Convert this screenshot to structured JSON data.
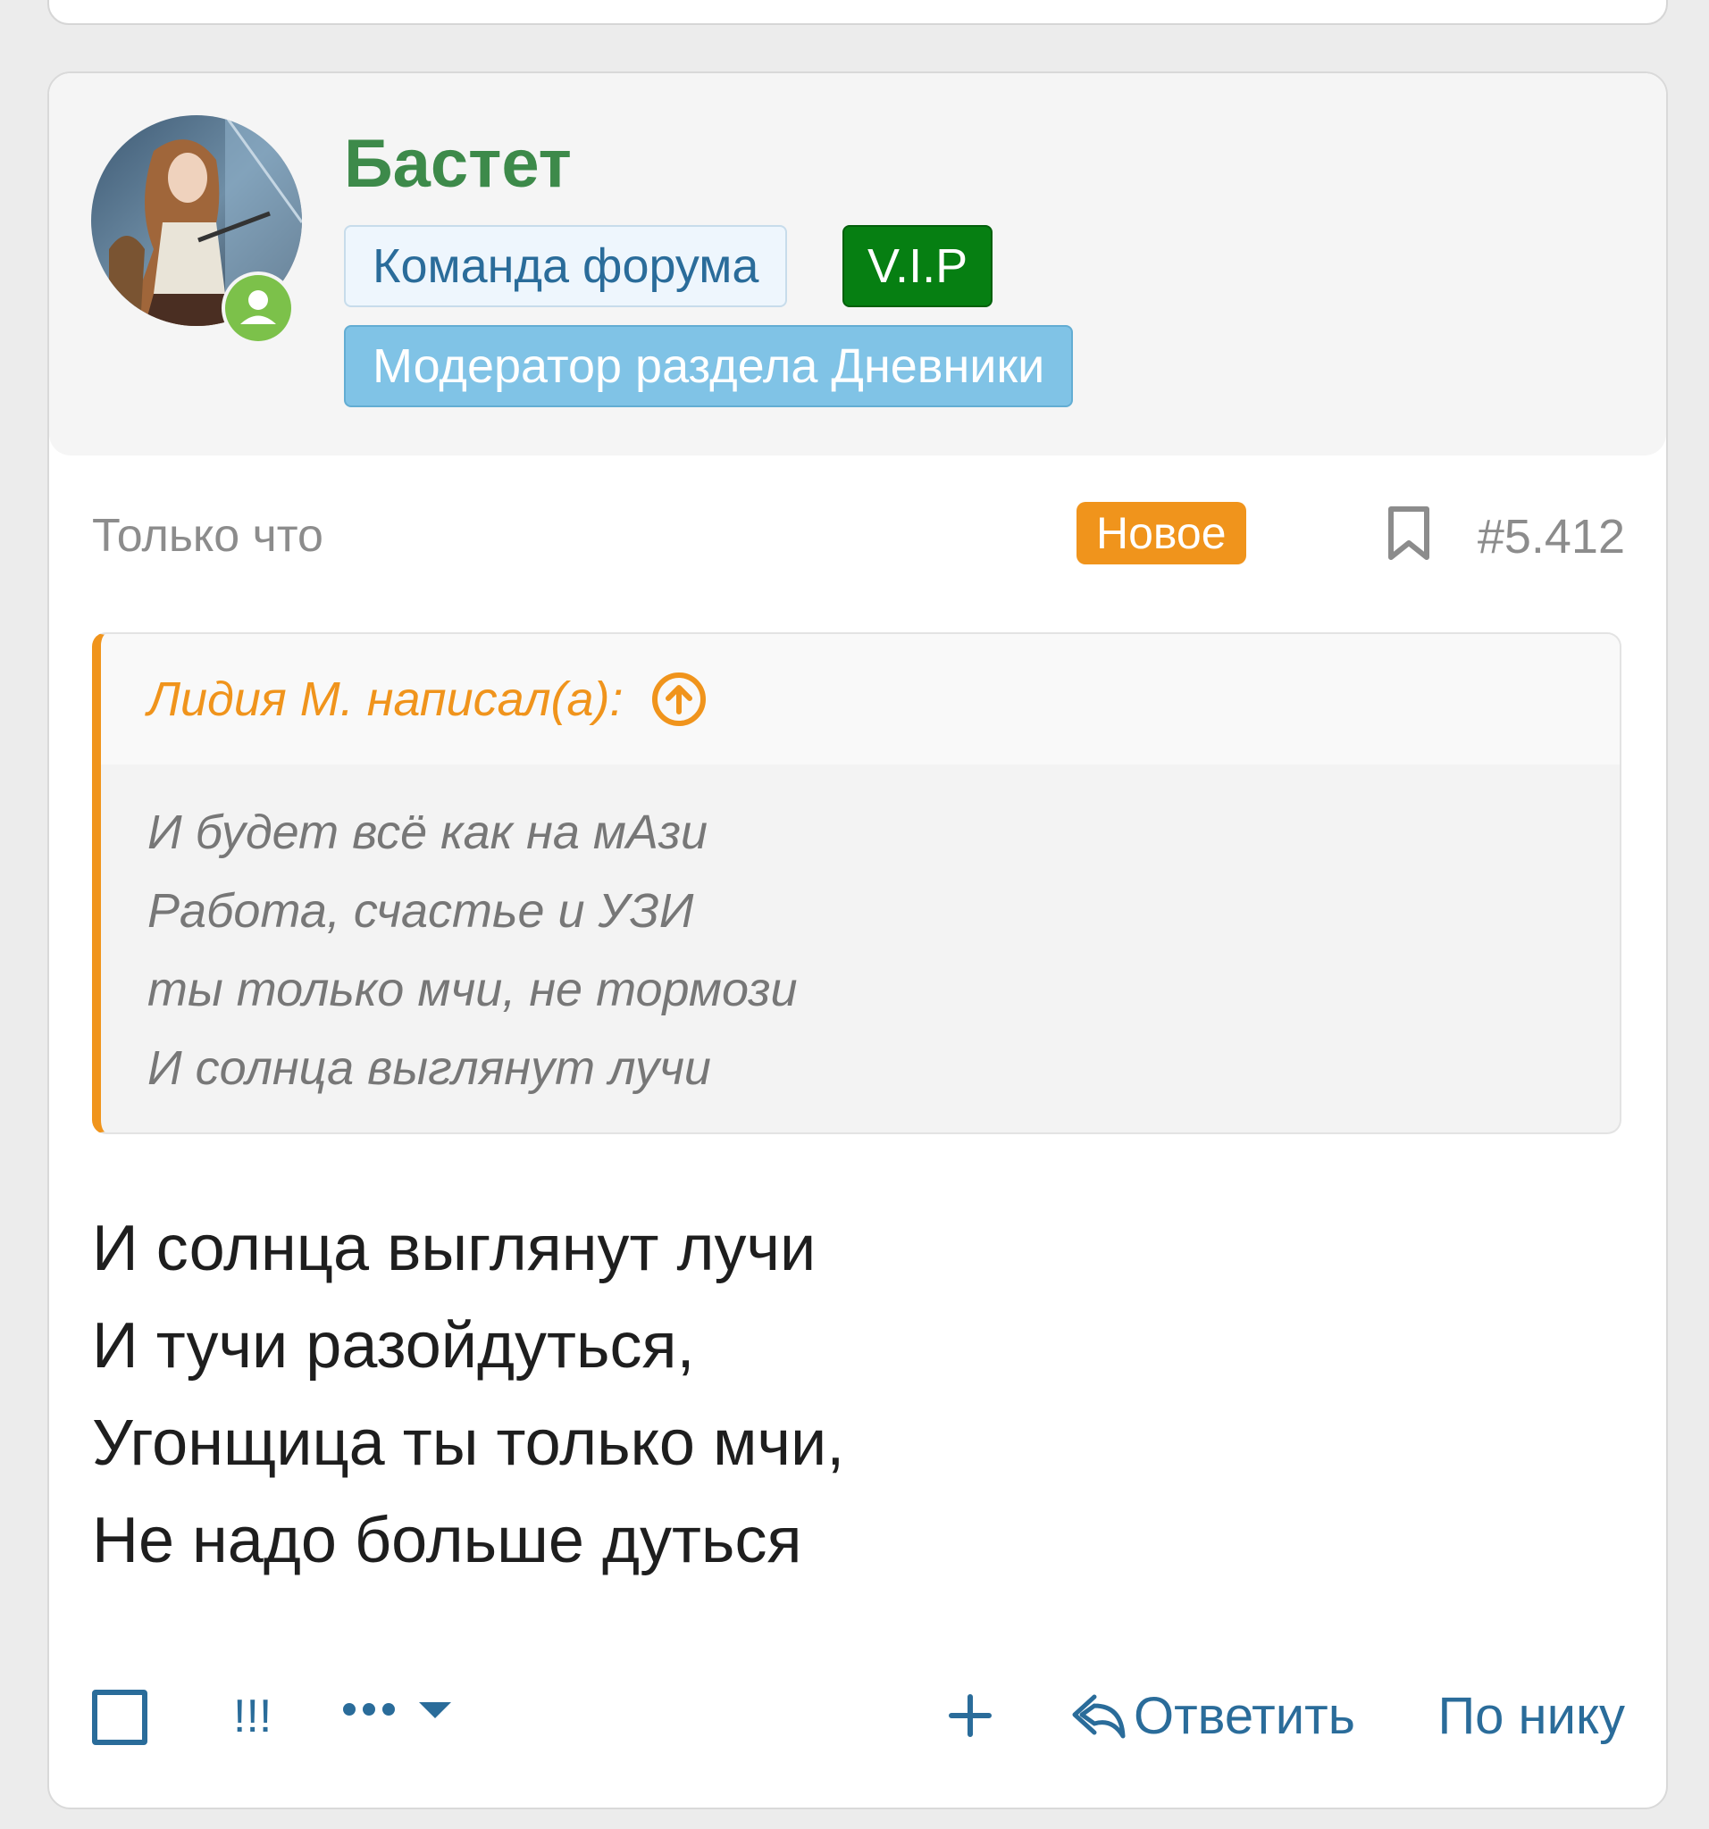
{
  "user": {
    "name": "Бастет",
    "badges": {
      "team": "Команда форума",
      "vip": "V.I.P",
      "moderator": "Модератор раздела Дневники"
    },
    "status_icon": "online-user-icon"
  },
  "post": {
    "time": "Только что",
    "new_label": "Новое",
    "number": "#5.412",
    "quote": {
      "author": "Лидия М. написал(а):",
      "lines": [
        "И будет всё как на мАзи",
        "Работа, счастье и УЗИ",
        "ты только мчи, не тормози",
        "И солнца выглянут лучи"
      ]
    },
    "message_lines": [
      "И солнца выглянут лучи",
      "И тучи разойдуться,",
      "Угонщица ты только мчи,",
      "Не надо больше дуться"
    ]
  },
  "actions": {
    "report": "!!!",
    "reply": "Ответить",
    "by_nick": "По нику"
  },
  "colors": {
    "accent": "#2a6c9a",
    "username": "#3d8a4a",
    "new_badge": "#f0941c",
    "vip_badge": "#067f12",
    "moderator_badge": "#80c3e6"
  }
}
